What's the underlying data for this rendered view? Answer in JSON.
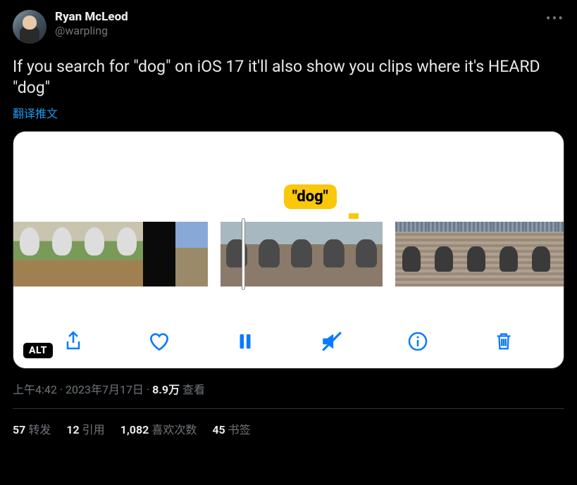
{
  "author": {
    "display_name": "Ryan McLeod",
    "handle": "@warpling"
  },
  "tweet_text": "If you search for \"dog\" on iOS 17 it'll also show you clips where it's HEARD \"dog\"",
  "translate_label": "翻译推文",
  "media": {
    "bubble_label": "\"dog\"",
    "alt_badge": "ALT"
  },
  "timestamp": {
    "time": "上午4:42",
    "date": "2023年7月17日",
    "views_count": "8.9万",
    "views_label": "查看"
  },
  "stats": {
    "retweets_count": "57",
    "retweets_label": "转发",
    "quotes_count": "12",
    "quotes_label": "引用",
    "likes_count": "1,082",
    "likes_label": "喜欢次数",
    "bookmarks_count": "45",
    "bookmarks_label": "书签"
  }
}
